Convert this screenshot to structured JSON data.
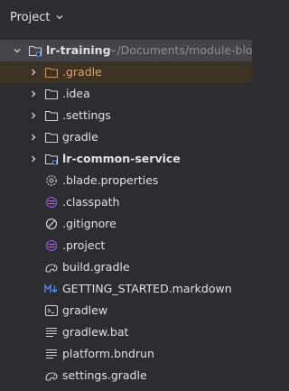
{
  "header": {
    "title": "Project"
  },
  "root": {
    "name": "lr-training",
    "path": "~/Documents/module-blo"
  },
  "items": [
    {
      "name": ".gradle",
      "icon": "folder-excluded-icon"
    },
    {
      "name": ".idea",
      "icon": "folder-icon"
    },
    {
      "name": ".settings",
      "icon": "folder-icon"
    },
    {
      "name": "gradle",
      "icon": "folder-icon"
    },
    {
      "name": "lr-common-service",
      "icon": "module-folder-icon"
    },
    {
      "name": ".blade.properties",
      "icon": "gear-icon"
    },
    {
      "name": ".classpath",
      "icon": "eclipse-icon"
    },
    {
      "name": ".gitignore",
      "icon": "ignore-icon"
    },
    {
      "name": ".project",
      "icon": "eclipse-icon"
    },
    {
      "name": "build.gradle",
      "icon": "gradle-icon"
    },
    {
      "name": "GETTING_STARTED.markdown",
      "icon": "markdown-icon"
    },
    {
      "name": "gradlew",
      "icon": "terminal-icon"
    },
    {
      "name": "gradlew.bat",
      "icon": "text-file-icon"
    },
    {
      "name": "platform.bndrun",
      "icon": "text-file-icon"
    },
    {
      "name": "settings.gradle",
      "icon": "gradle-icon"
    }
  ],
  "colors": {
    "background": "#2b2d30",
    "selected_row": "#43454a",
    "excluded_row": "#3d3223",
    "excluded_text": "#e0a366",
    "folder_stroke": "#ced0d6",
    "excluded_folder": "#e08855",
    "eclipse": "#7b68ee"
  }
}
